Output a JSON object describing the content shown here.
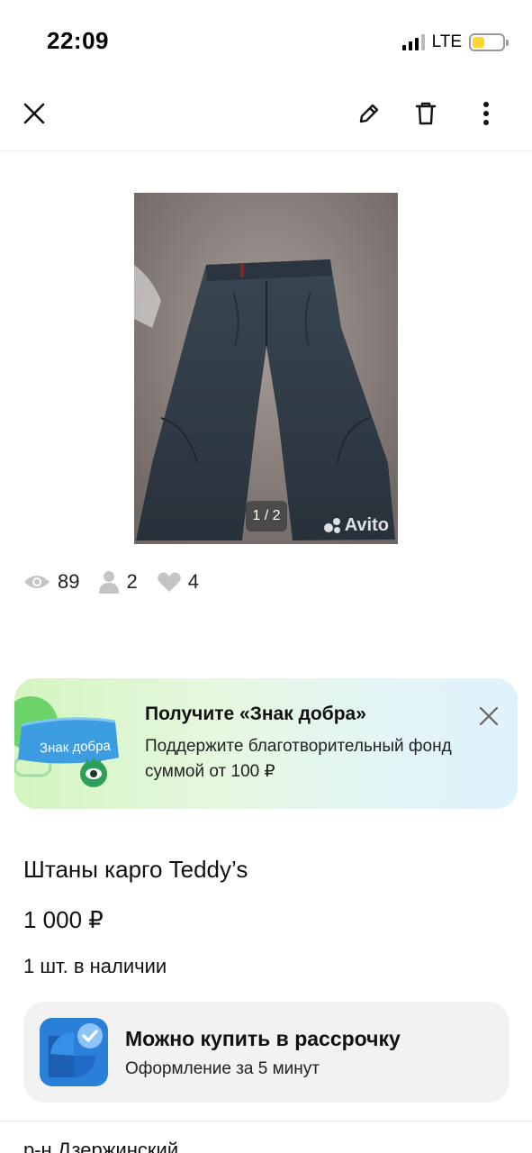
{
  "status_bar": {
    "time": "22:09",
    "network": "LTE",
    "battery_level": 0.4,
    "battery_color": "#ffd52e"
  },
  "toolbar": {
    "close_icon": "close-icon",
    "edit_icon": "pencil-icon",
    "delete_icon": "trash-icon",
    "more_icon": "more-vertical-icon"
  },
  "gallery": {
    "counter": "1 / 2",
    "current": 1,
    "total": 2,
    "watermark": "Avito"
  },
  "stats": {
    "views": "89",
    "contacts": "2",
    "favorites": "4",
    "icons": [
      "eye-icon",
      "person-icon",
      "heart-icon"
    ]
  },
  "charity_banner": {
    "badge_text": "Знак добра",
    "title": "Получите «Знак добра»",
    "text": "Поддержите благотворительный фонд суммой от 100 ₽",
    "colors": {
      "start": "#d3f5bf",
      "end": "#dff1fb"
    }
  },
  "listing": {
    "title": "Штаны карго Teddy’s",
    "price": "1 000 ₽",
    "stock": "1 шт. в наличии",
    "location": "р-н Дзержинский"
  },
  "installment": {
    "title": "Можно купить в рассрочку",
    "subtitle": "Оформление за 5 минут",
    "accent": "#2a80d8"
  }
}
